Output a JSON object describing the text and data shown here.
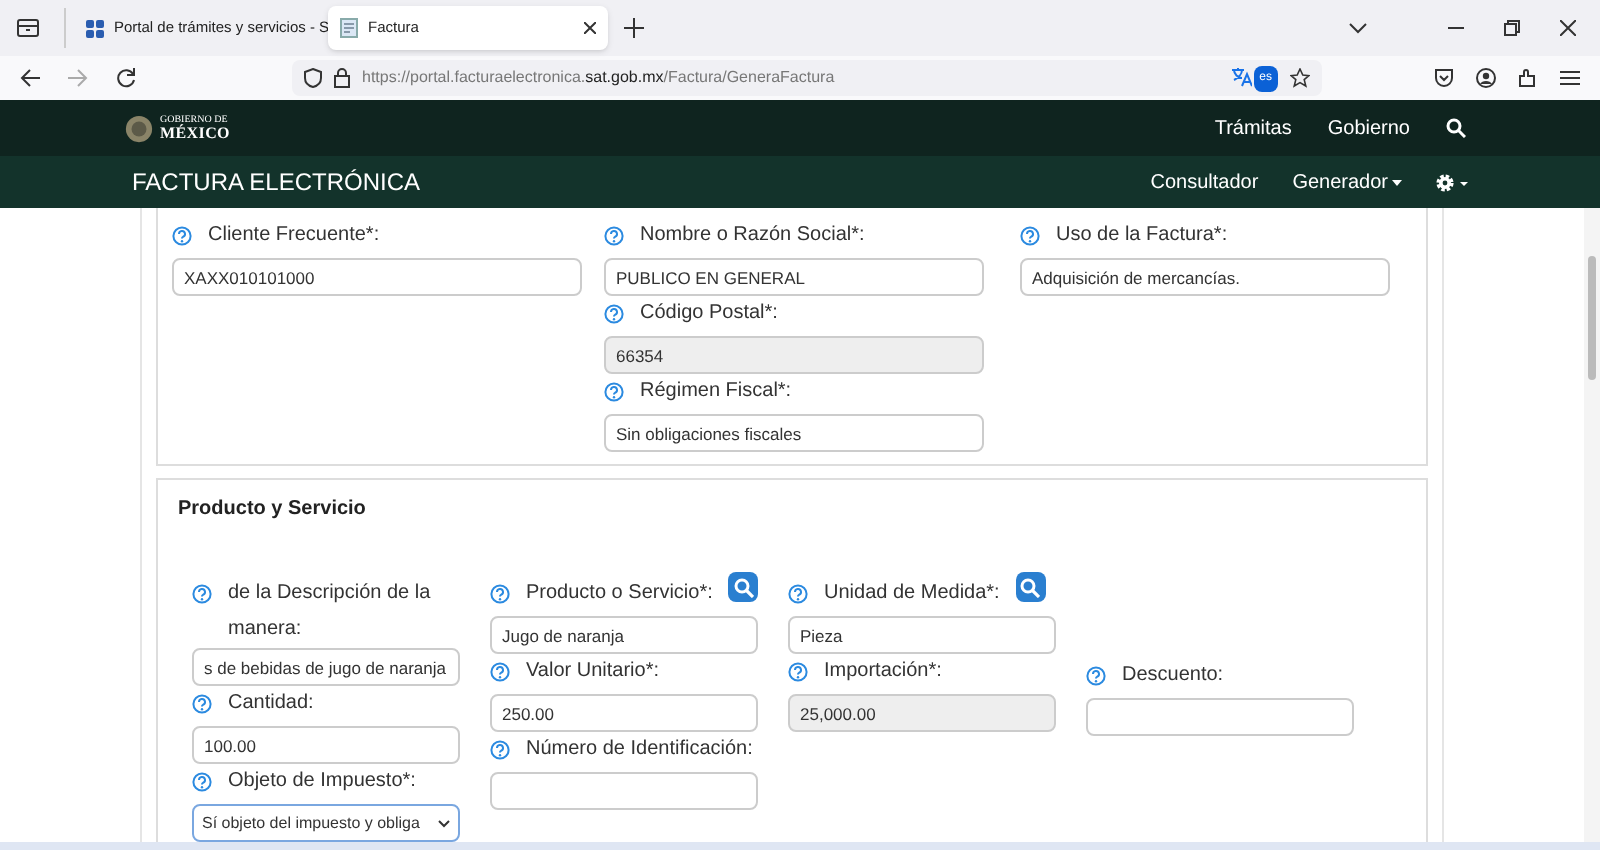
{
  "browser": {
    "tabs": [
      {
        "title": "Portal de trámites y servicios - S",
        "selected": false
      },
      {
        "title": "Factura",
        "selected": true
      }
    ],
    "url_prefix": "https://portal.facturaelectronica.",
    "url_host": "sat.gob.mx",
    "url_path": "/Factura/GeneraFactura",
    "translate_badge": "es"
  },
  "site_header": {
    "logo_top": "GOBIERNO DE",
    "logo_bottom": "MÉXICO",
    "top_links": [
      "Trámitas",
      "Gobierno"
    ],
    "app_title": "FACTURA ELECTRÓNICA",
    "nav": [
      {
        "label": "Consultador",
        "dropdown": false
      },
      {
        "label": "Generador",
        "dropdown": true
      }
    ]
  },
  "client_section": {
    "columns": [
      [
        {
          "label": "Cliente Frecuente*:",
          "value": "XAXX010101000",
          "disabled": false
        }
      ],
      [
        {
          "label": "Nombre o Razón Social*:",
          "value": "PUBLICO EN GENERAL",
          "disabled": false
        },
        {
          "label": "Código Postal*:",
          "value": "66354",
          "disabled": true
        },
        {
          "label": "Régimen Fiscal*:",
          "value": "Sin obligaciones fiscales",
          "disabled": false
        }
      ],
      [
        {
          "label": "Uso de la Factura*:",
          "value": "Adquisición de mercancías.",
          "disabled": false
        }
      ]
    ]
  },
  "product_section": {
    "title": "Producto y Servicio",
    "columns": [
      [
        {
          "kind": "input",
          "label": "de la Descripción de la manera:",
          "value": "s de bebidas de jugo de naranja",
          "disabled": false
        },
        {
          "kind": "input",
          "label": "Cantidad:",
          "value": "100.00",
          "disabled": false
        },
        {
          "kind": "select",
          "label": "Objeto de Impuesto*:",
          "value": "Sí objeto del impuesto y obliga"
        }
      ],
      [
        {
          "kind": "input",
          "label": "Producto o Servicio*:",
          "value": "Jugo de naranja",
          "disabled": false,
          "search": true
        },
        {
          "kind": "input",
          "label": "Valor Unitario*:",
          "value": "250.00",
          "disabled": false
        },
        {
          "kind": "input",
          "label": "Número de Identificación:",
          "disabled": false
        }
      ],
      [
        {
          "kind": "input",
          "label": "Unidad de Medida*:",
          "value": "Pieza",
          "disabled": false,
          "search": true
        },
        {
          "kind": "input",
          "label": "Importación*:",
          "value": "25,000.00",
          "disabled": true
        }
      ],
      [
        {
          "kind": "spacer"
        },
        {
          "kind": "input",
          "label": "Descuento:",
          "disabled": false
        }
      ]
    ]
  }
}
